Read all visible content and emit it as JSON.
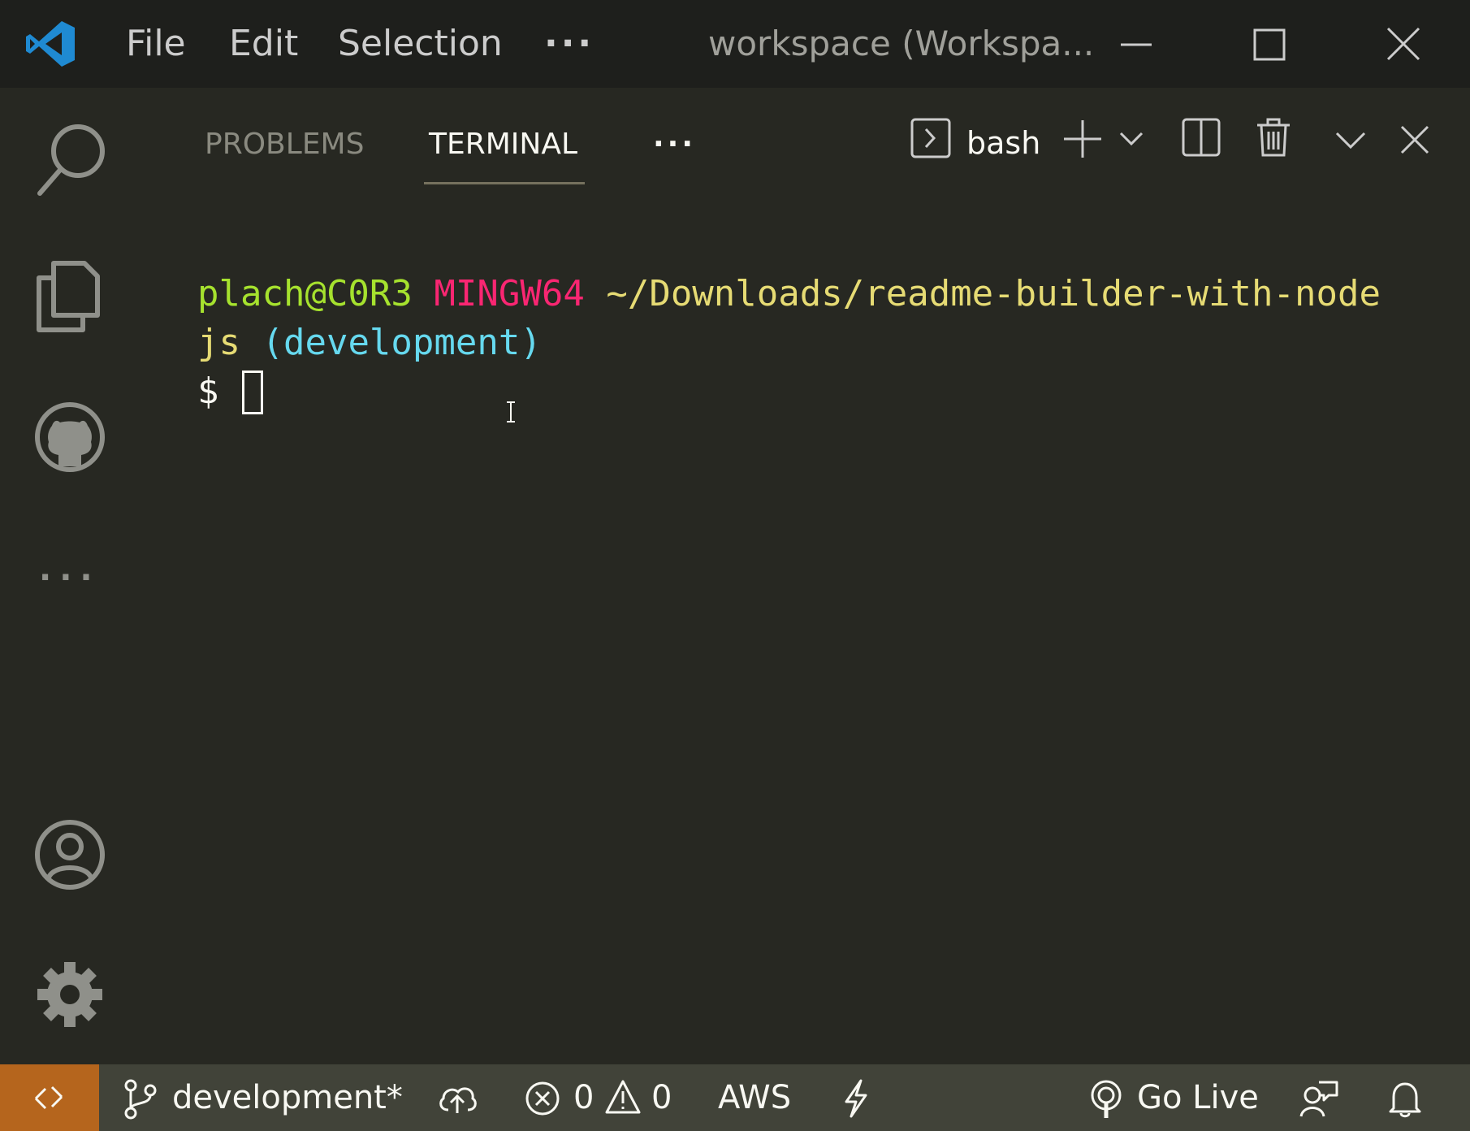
{
  "titlebar": {
    "menu": [
      "File",
      "Edit",
      "Selection"
    ],
    "more": "···",
    "title": "workspace (Workspa..."
  },
  "panel": {
    "tabs": [
      "PROBLEMS",
      "TERMINAL"
    ],
    "active_tab": "TERMINAL",
    "more": "···",
    "terminal_name": "bash"
  },
  "terminal": {
    "user": "plach@C0R3",
    "system": "MINGW64",
    "path_part1": "~/Downloads/readme-builder-with-node",
    "path_part2": "js",
    "branch": "(development)",
    "prompt": "$"
  },
  "activitybar": {
    "more": "···"
  },
  "statusbar": {
    "branch": "development*",
    "errors": "0",
    "warnings": "0",
    "aws": "AWS",
    "go_live": "Go Live"
  },
  "colors": {
    "titlebar_bg": "#1e1f1c",
    "editor_bg": "#272822",
    "statusbar_bg": "#414339",
    "remote_bg": "#b5651d",
    "user_green": "#a6e22e",
    "system_magenta": "#f92672",
    "path_yellow": "#e6db74",
    "branch_cyan": "#66d9ef"
  }
}
